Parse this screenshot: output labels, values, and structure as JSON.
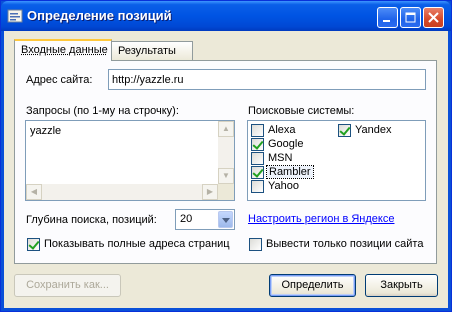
{
  "window": {
    "title": "Определение позиций",
    "controls": [
      "minimize-icon",
      "maximize-icon",
      "close-icon"
    ]
  },
  "tabs": [
    {
      "label": "Входные данные",
      "active": true
    },
    {
      "label": "Результаты",
      "active": false
    }
  ],
  "site": {
    "label": "Адрес сайта:",
    "value": "http://yazzle.ru"
  },
  "queries": {
    "label": "Запросы (по 1-му на строчку):",
    "value": "yazzle"
  },
  "search_engines": {
    "label": "Поисковые системы:",
    "items": [
      {
        "name": "Alexa",
        "checked": false
      },
      {
        "name": "Yandex",
        "checked": true
      },
      {
        "name": "Google",
        "checked": true
      },
      {
        "name": "MSN",
        "checked": false
      },
      {
        "name": "Rambler",
        "checked": true
      },
      {
        "name": "Yahoo",
        "checked": false
      }
    ]
  },
  "depth": {
    "label": "Глубина поиска, позиций:",
    "value": "20"
  },
  "region_link": "Настроить регион в Яндексе",
  "options": {
    "full_urls": {
      "label": "Показывать полные адреса страниц",
      "checked": true
    },
    "site_only": {
      "label": "Вывести только позиции сайта",
      "checked": false
    }
  },
  "buttons": {
    "save": "Сохранить как...",
    "determine": "Определить",
    "close": "Закрыть"
  },
  "colors": {
    "title_bar": "#0054e3",
    "dialog_bg": "#ece9d8",
    "link": "#0000ff",
    "check": "#21a121"
  }
}
